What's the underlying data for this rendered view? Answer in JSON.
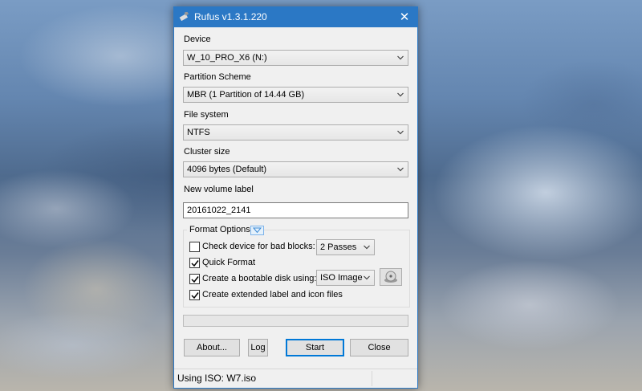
{
  "window": {
    "title": "Rufus v1.3.1.220"
  },
  "fields": {
    "device": {
      "label": "Device",
      "value": "W_10_PRO_X6 (N:)"
    },
    "partition": {
      "label": "Partition Scheme",
      "value": "MBR (1 Partition of 14.44 GB)"
    },
    "filesystem": {
      "label": "File system",
      "value": "NTFS"
    },
    "cluster": {
      "label": "Cluster size",
      "value": "4096 bytes (Default)"
    },
    "volume": {
      "label": "New volume label",
      "value": "20161022_2141"
    }
  },
  "format_options": {
    "title": "Format Options",
    "bad_blocks": {
      "label": "Check device for bad blocks:",
      "checked": false,
      "passes": "2 Passes"
    },
    "quick_format": {
      "label": "Quick Format",
      "checked": true
    },
    "bootable": {
      "label": "Create a bootable disk using:",
      "checked": true,
      "type": "ISO Image"
    },
    "extended_label": {
      "label": "Create extended label and icon files",
      "checked": true
    }
  },
  "progress": {
    "value": 0
  },
  "buttons": {
    "about": "About...",
    "log": "Log",
    "start": "Start",
    "close": "Close"
  },
  "status": {
    "text": "Using ISO: W7.iso"
  },
  "icons": {
    "app": "usb-drive-icon",
    "close": "close-icon",
    "dropdown": "chevron-down-icon",
    "disk": "disk-image-icon"
  }
}
